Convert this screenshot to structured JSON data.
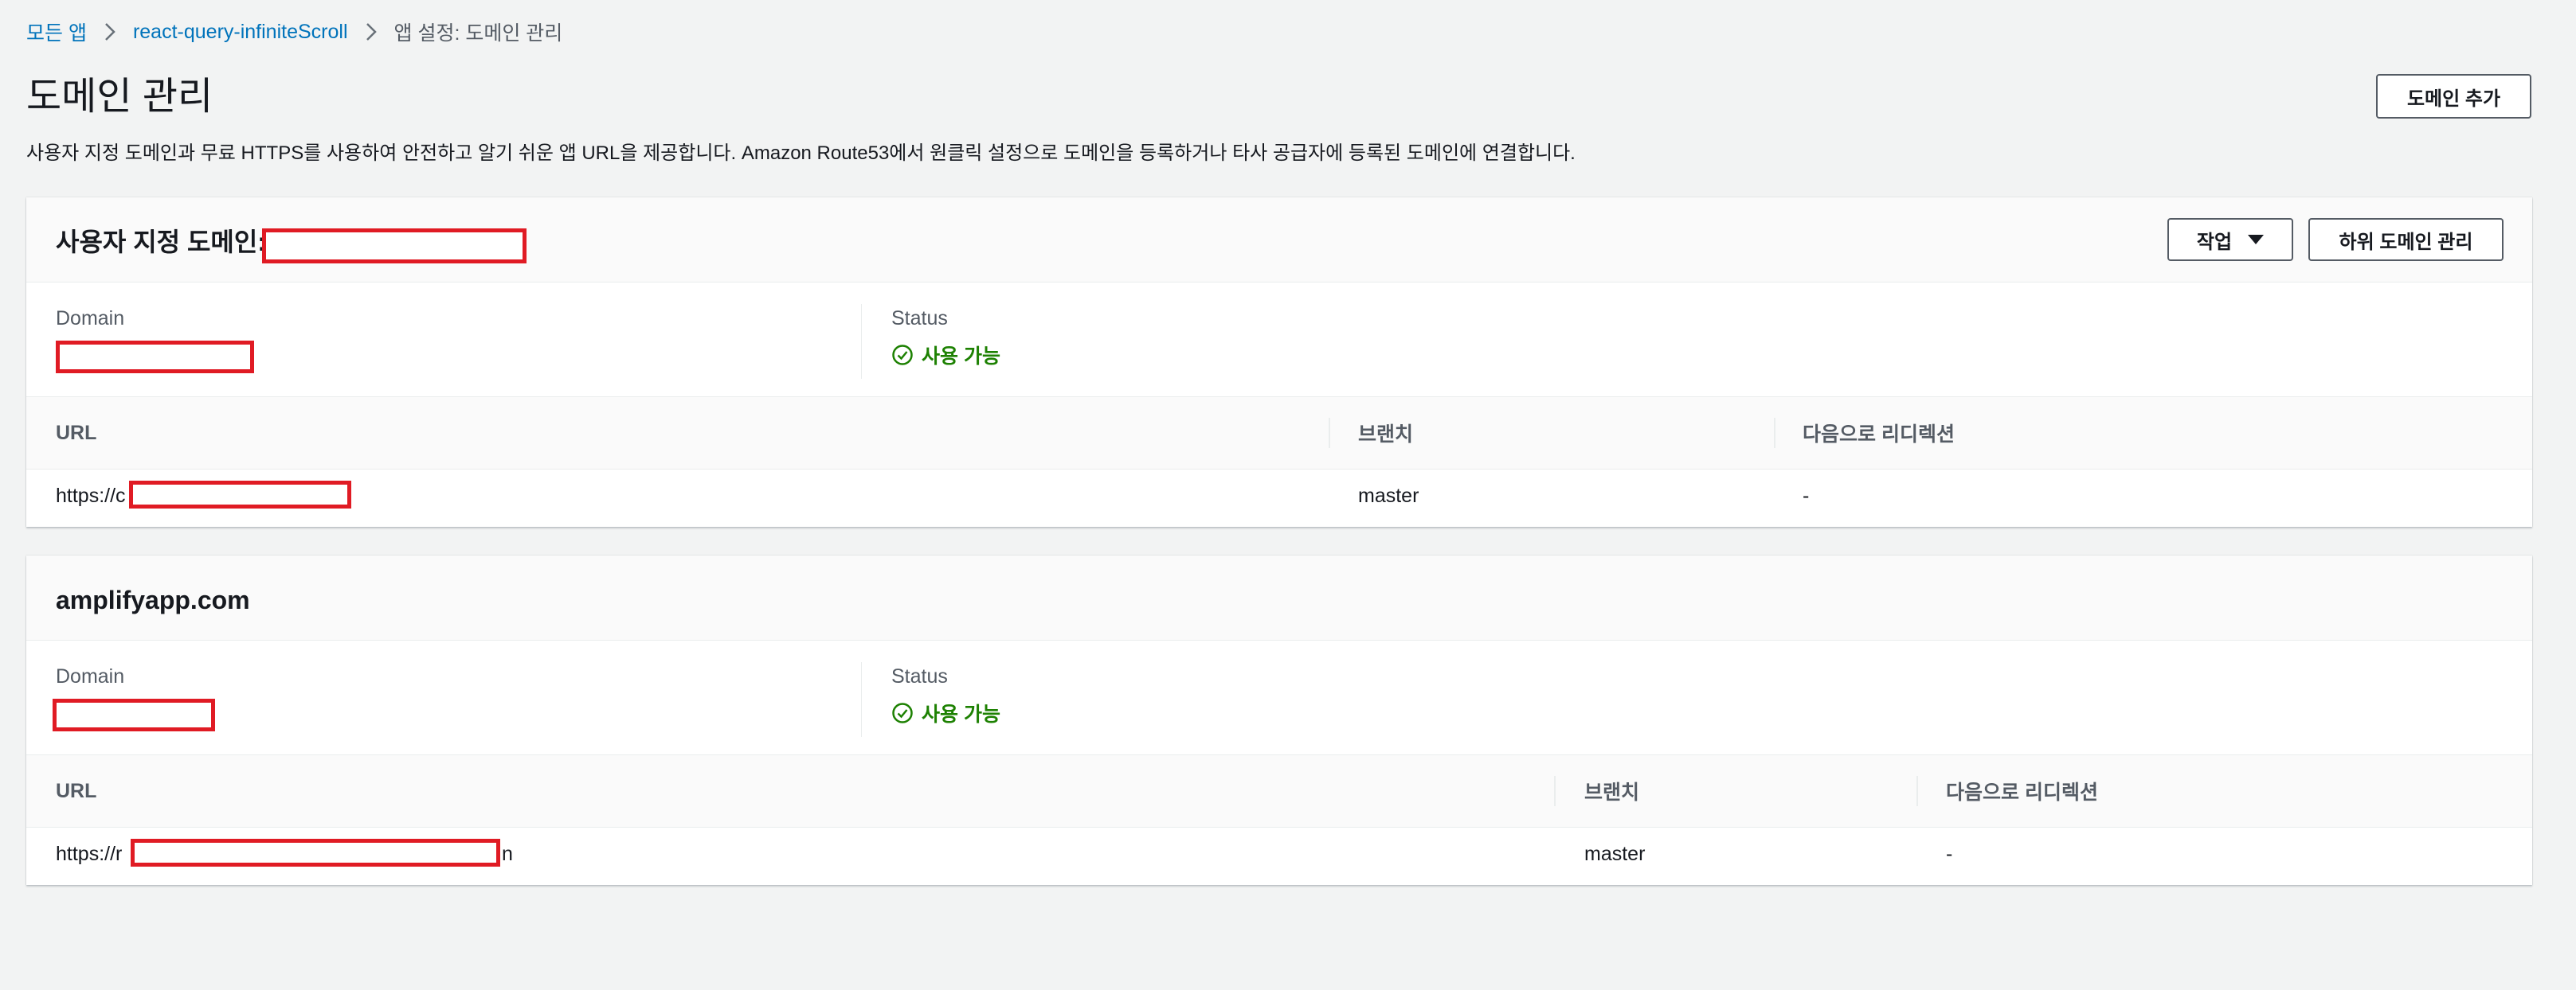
{
  "breadcrumb": {
    "items": [
      "모든 앱",
      "react-query-infiniteScroll"
    ],
    "current": "앱 설정: 도메인 관리"
  },
  "page": {
    "title": "도메인 관리",
    "description": "사용자 지정 도메인과 무료 HTTPS를 사용하여 안전하고 알기 쉬운 앱 URL을 제공합니다. Amazon Route53에서 원클릭 설정으로 도메인을 등록하거나 타사 공급자에 등록된 도메인에 연결합니다.",
    "add_domain_button": "도메인 추가"
  },
  "custom_domain_panel": {
    "title": "사용자 지정 도메인:",
    "actions_button": "작업",
    "manage_subdomains_button": "하위 도메인 관리",
    "domain_label": "Domain",
    "status_label": "Status",
    "status_value": "사용 가능",
    "columns": [
      "URL",
      "브랜치",
      "다음으로 리디렉션"
    ],
    "row": {
      "url_prefix": "https://c",
      "branch": "master",
      "redirect": "-"
    }
  },
  "amplify_panel": {
    "title": "amplifyapp.com",
    "domain_label": "Domain",
    "status_label": "Status",
    "status_value": "사용 가능",
    "columns": [
      "URL",
      "브랜치",
      "다음으로 리디렉션"
    ],
    "row": {
      "url_prefix": "https://r",
      "url_suffix": "n",
      "branch": "master",
      "redirect": "-"
    }
  },
  "colors": {
    "link": "#0073bb",
    "success": "#1d8102",
    "redaction": "#e01b24",
    "background": "#f2f3f3"
  }
}
